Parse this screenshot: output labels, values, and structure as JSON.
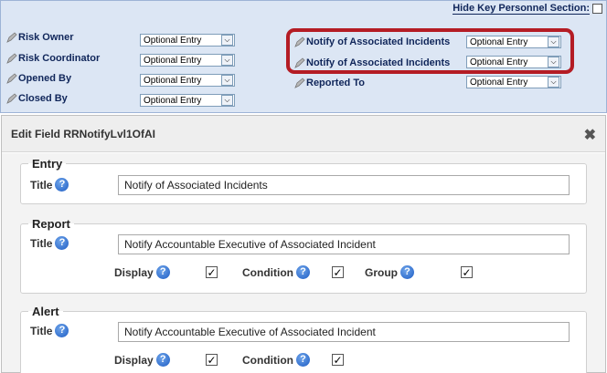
{
  "top_panel": {
    "hide_key_label": "Hide Key Personnel Section:",
    "left_fields": [
      {
        "label": "Risk Owner",
        "value": "Optional Entry"
      },
      {
        "label": "Risk Coordinator",
        "value": "Optional Entry"
      },
      {
        "label": "Opened By",
        "value": "Optional Entry"
      },
      {
        "label": "Closed By",
        "value": "Optional Entry"
      }
    ],
    "right_fields": [
      {
        "label": "Notify of Associated Incidents",
        "value": "Optional Entry"
      },
      {
        "label": "Notify of Associated Incidents",
        "value": "Optional Entry"
      },
      {
        "label": "Reported To",
        "value": "Optional Entry"
      }
    ],
    "highlight_color": "#b41c24"
  },
  "dialog": {
    "title": "Edit Field RRNotifyLvl1OfAI",
    "close_icon": "close-x-icon",
    "entry": {
      "legend": "Entry",
      "title_label": "Title",
      "title_value": "Notify of Associated Incidents"
    },
    "report": {
      "legend": "Report",
      "title_label": "Title",
      "title_value": "Notify Accountable Executive of Associated Incident",
      "display_label": "Display",
      "condition_label": "Condition",
      "group_label": "Group",
      "display_checked": true,
      "condition_checked": true,
      "group_checked": true
    },
    "alert": {
      "legend": "Alert",
      "title_label": "Title",
      "title_value": "Notify Accountable Executive of Associated Incident",
      "display_label": "Display",
      "condition_label": "Condition",
      "display_checked": true,
      "condition_checked": true
    },
    "help_glyph": "?",
    "check_glyph": "✓",
    "arrow_glyph": "⌵"
  }
}
